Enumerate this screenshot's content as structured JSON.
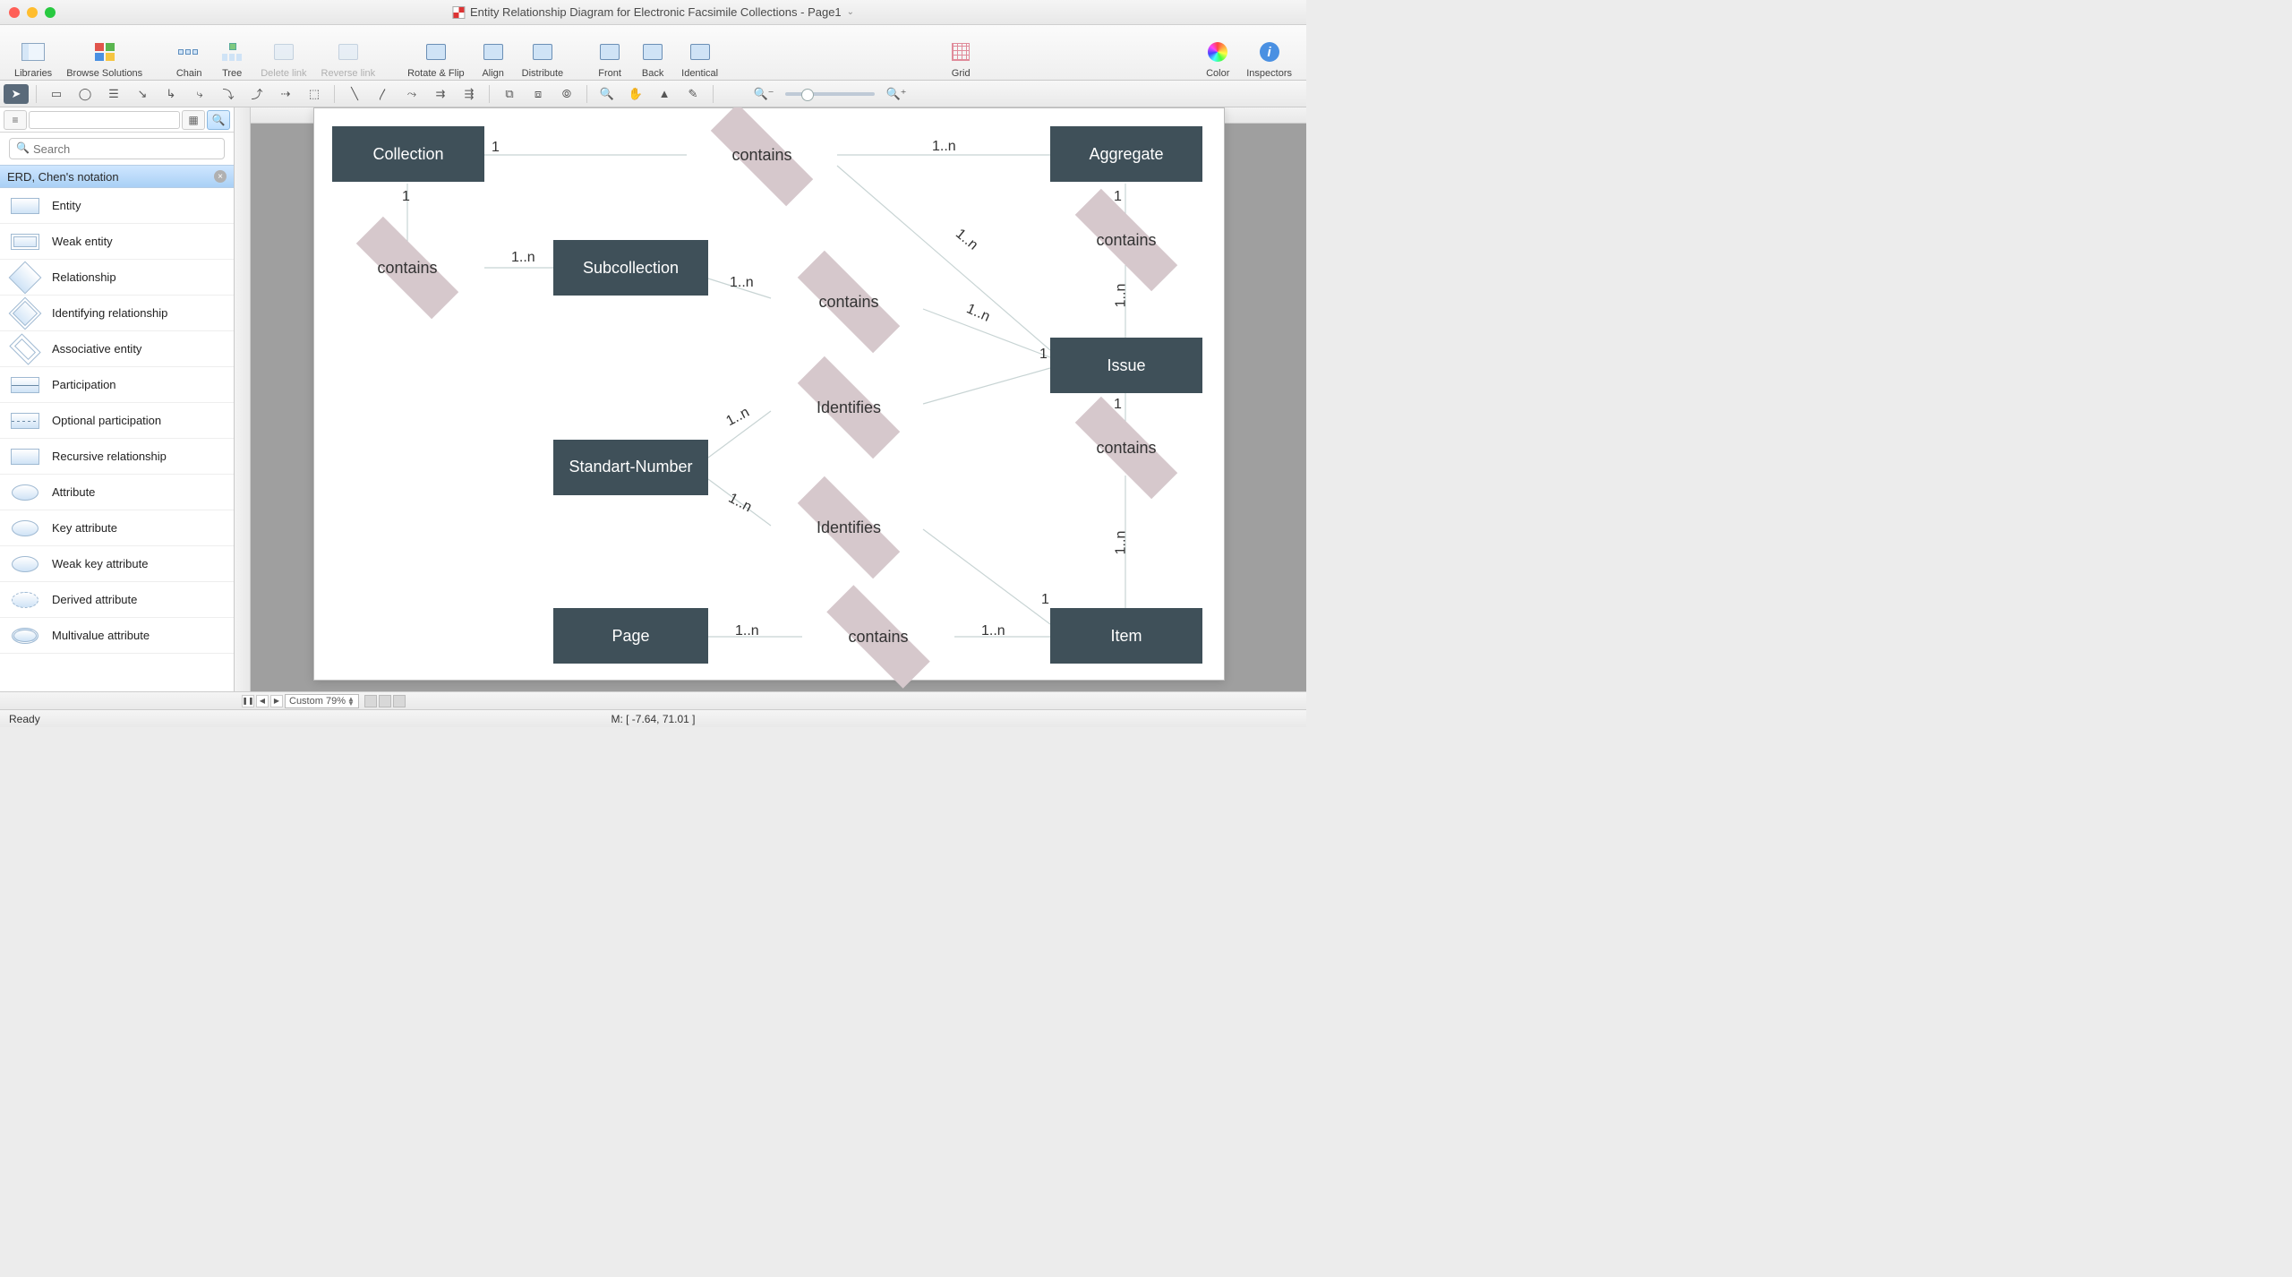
{
  "titlebar": {
    "title": "Entity Relationship Diagram for Electronic Facsimile Collections - Page1"
  },
  "toolbar": {
    "libraries": "Libraries",
    "browse_solutions": "Browse Solutions",
    "chain": "Chain",
    "tree": "Tree",
    "delete_link": "Delete link",
    "reverse_link": "Reverse link",
    "rotate_flip": "Rotate & Flip",
    "align": "Align",
    "distribute": "Distribute",
    "front": "Front",
    "back": "Back",
    "identical": "Identical",
    "grid": "Grid",
    "color": "Color",
    "inspectors": "Inspectors"
  },
  "sidebar": {
    "search_placeholder": "Search",
    "library_title": "ERD, Chen's notation",
    "items": [
      "Entity",
      "Weak entity",
      "Relationship",
      "Identifying relationship",
      "Associative entity",
      "Participation",
      "Optional participation",
      "Recursive relationship",
      "Attribute",
      "Key attribute",
      "Weak key attribute",
      "Derived attribute",
      "Multivalue attribute"
    ]
  },
  "diagram": {
    "entities": {
      "collection": "Collection",
      "aggregate": "Aggregate",
      "subcollection": "Subcollection",
      "issue": "Issue",
      "standart_number": "Standart-Number",
      "page": "Page",
      "item": "Item"
    },
    "relationships": {
      "contains": "contains",
      "identifies": "Identifies"
    },
    "cardinalities": {
      "one": "1",
      "one_n": "1..n"
    }
  },
  "bottombar": {
    "zoom": "Custom 79%"
  },
  "statusbar": {
    "ready": "Ready",
    "mouse": "M: [ -7.64, 71.01 ]"
  }
}
